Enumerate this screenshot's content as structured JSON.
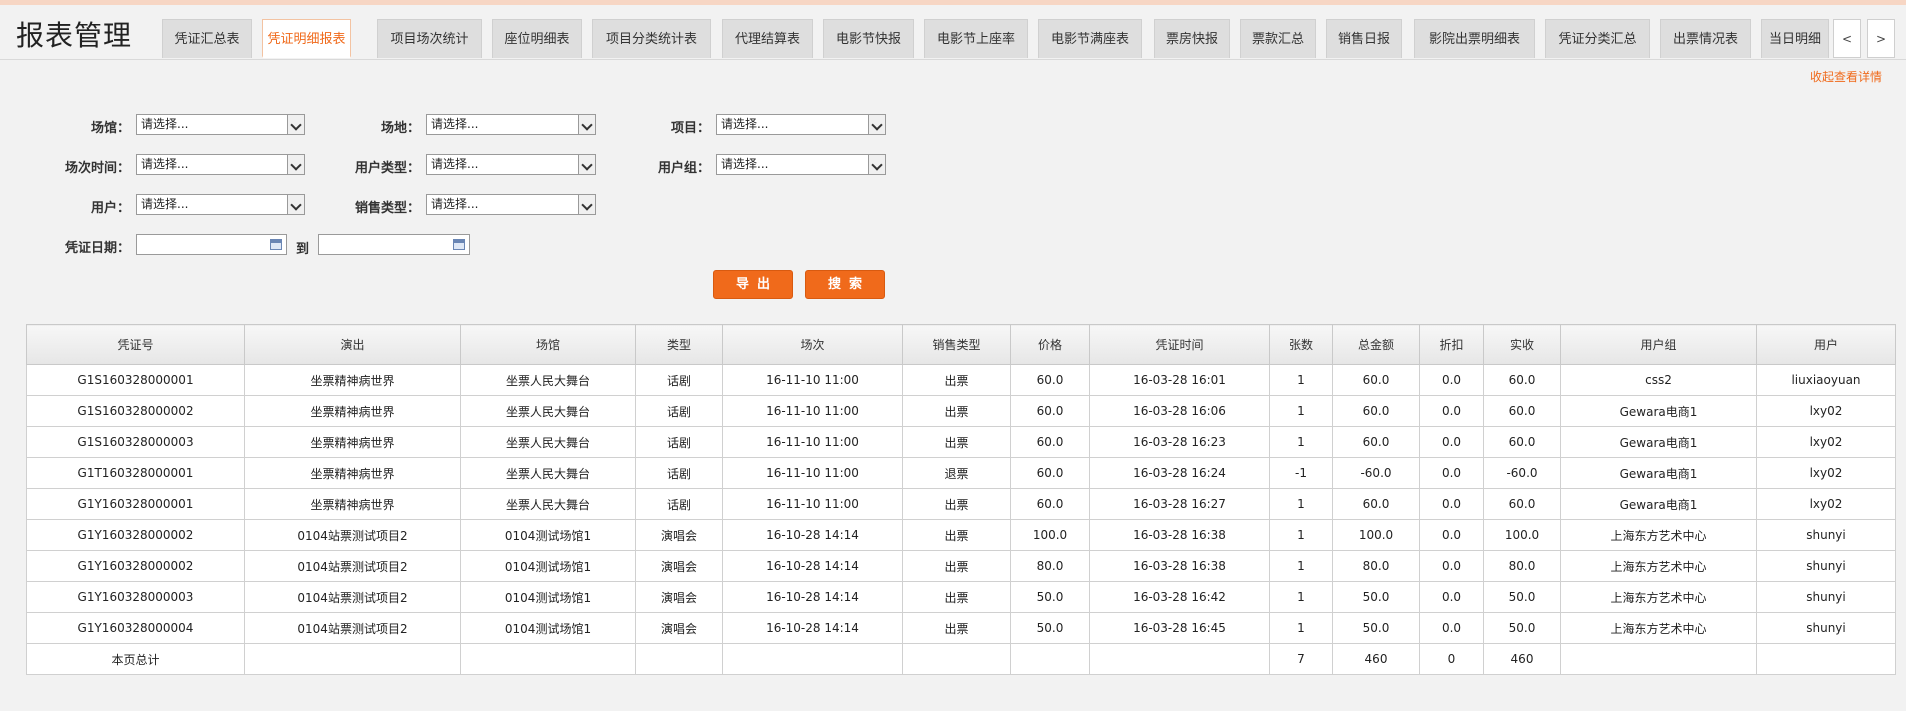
{
  "app": {
    "title": "报表管理"
  },
  "tabs": [
    {
      "label": "凭证汇总表",
      "active": false
    },
    {
      "label": "凭证明细报表",
      "active": true
    },
    {
      "label": "项目场次统计",
      "active": false
    },
    {
      "label": "座位明细表",
      "active": false
    },
    {
      "label": "项目分类统计表",
      "active": false
    },
    {
      "label": "代理结算表",
      "active": false
    },
    {
      "label": "电影节快报",
      "active": false
    },
    {
      "label": "电影节上座率",
      "active": false
    },
    {
      "label": "电影节满座表",
      "active": false
    },
    {
      "label": "票房快报",
      "active": false
    },
    {
      "label": "票款汇总",
      "active": false
    },
    {
      "label": "销售日报",
      "active": false
    },
    {
      "label": "影院出票明细表",
      "active": false
    },
    {
      "label": "凭证分类汇总",
      "active": false
    },
    {
      "label": "出票情况表",
      "active": false
    },
    {
      "label": "当日明细",
      "active": false
    }
  ],
  "tab_nav": {
    "prev": "<",
    "next": ">"
  },
  "toggle_link": "收起查看详情",
  "filters": {
    "venue": {
      "label": "场馆：",
      "value": "请选择..."
    },
    "site": {
      "label": "场地：",
      "value": "请选择..."
    },
    "project": {
      "label": "项目：",
      "value": "请选择..."
    },
    "show_time": {
      "label": "场次时间：",
      "value": "请选择..."
    },
    "user_type": {
      "label": "用户类型：",
      "value": "请选择..."
    },
    "user_group": {
      "label": "用户组：",
      "value": "请选择..."
    },
    "user": {
      "label": "用户：",
      "value": "请选择..."
    },
    "sale_type": {
      "label": "销售类型：",
      "value": "请选择..."
    },
    "voucher_date": {
      "label": "凭证日期：",
      "from": "",
      "to_label": "到",
      "to": ""
    }
  },
  "buttons": {
    "export": "导出",
    "search": "搜索"
  },
  "table": {
    "columns": [
      "凭证号",
      "演出",
      "场馆",
      "类型",
      "场次",
      "销售类型",
      "价格",
      "凭证时间",
      "张数",
      "总金额",
      "折扣",
      "实收",
      "用户组",
      "用户"
    ],
    "rows": [
      [
        "G1S160328000001",
        "坐票精神病世界",
        "坐票人民大舞台",
        "话剧",
        "16-11-10 11:00",
        "出票",
        "60.0",
        "16-03-28 16:01",
        "1",
        "60.0",
        "0.0",
        "60.0",
        "css2",
        "liuxiaoyuan"
      ],
      [
        "G1S160328000002",
        "坐票精神病世界",
        "坐票人民大舞台",
        "话剧",
        "16-11-10 11:00",
        "出票",
        "60.0",
        "16-03-28 16:06",
        "1",
        "60.0",
        "0.0",
        "60.0",
        "Gewara电商1",
        "lxy02"
      ],
      [
        "G1S160328000003",
        "坐票精神病世界",
        "坐票人民大舞台",
        "话剧",
        "16-11-10 11:00",
        "出票",
        "60.0",
        "16-03-28 16:23",
        "1",
        "60.0",
        "0.0",
        "60.0",
        "Gewara电商1",
        "lxy02"
      ],
      [
        "G1T160328000001",
        "坐票精神病世界",
        "坐票人民大舞台",
        "话剧",
        "16-11-10 11:00",
        "退票",
        "60.0",
        "16-03-28 16:24",
        "-1",
        "-60.0",
        "0.0",
        "-60.0",
        "Gewara电商1",
        "lxy02"
      ],
      [
        "G1Y160328000001",
        "坐票精神病世界",
        "坐票人民大舞台",
        "话剧",
        "16-11-10 11:00",
        "出票",
        "60.0",
        "16-03-28 16:27",
        "1",
        "60.0",
        "0.0",
        "60.0",
        "Gewara电商1",
        "lxy02"
      ],
      [
        "G1Y160328000002",
        "0104站票测试项目2",
        "0104测试场馆1",
        "演唱会",
        "16-10-28 14:14",
        "出票",
        "100.0",
        "16-03-28 16:38",
        "1",
        "100.0",
        "0.0",
        "100.0",
        "上海东方艺术中心",
        "shunyi"
      ],
      [
        "G1Y160328000002",
        "0104站票测试项目2",
        "0104测试场馆1",
        "演唱会",
        "16-10-28 14:14",
        "出票",
        "80.0",
        "16-03-28 16:38",
        "1",
        "80.0",
        "0.0",
        "80.0",
        "上海东方艺术中心",
        "shunyi"
      ],
      [
        "G1Y160328000003",
        "0104站票测试项目2",
        "0104测试场馆1",
        "演唱会",
        "16-10-28 14:14",
        "出票",
        "50.0",
        "16-03-28 16:42",
        "1",
        "50.0",
        "0.0",
        "50.0",
        "上海东方艺术中心",
        "shunyi"
      ],
      [
        "G1Y160328000004",
        "0104站票测试项目2",
        "0104测试场馆1",
        "演唱会",
        "16-10-28 14:14",
        "出票",
        "50.0",
        "16-03-28 16:45",
        "1",
        "50.0",
        "0.0",
        "50.0",
        "上海东方艺术中心",
        "shunyi"
      ]
    ],
    "footer": [
      "本页总计",
      "",
      "",
      "",
      "",
      "",
      "",
      "",
      "7",
      "460",
      "0",
      "460",
      "",
      ""
    ]
  }
}
